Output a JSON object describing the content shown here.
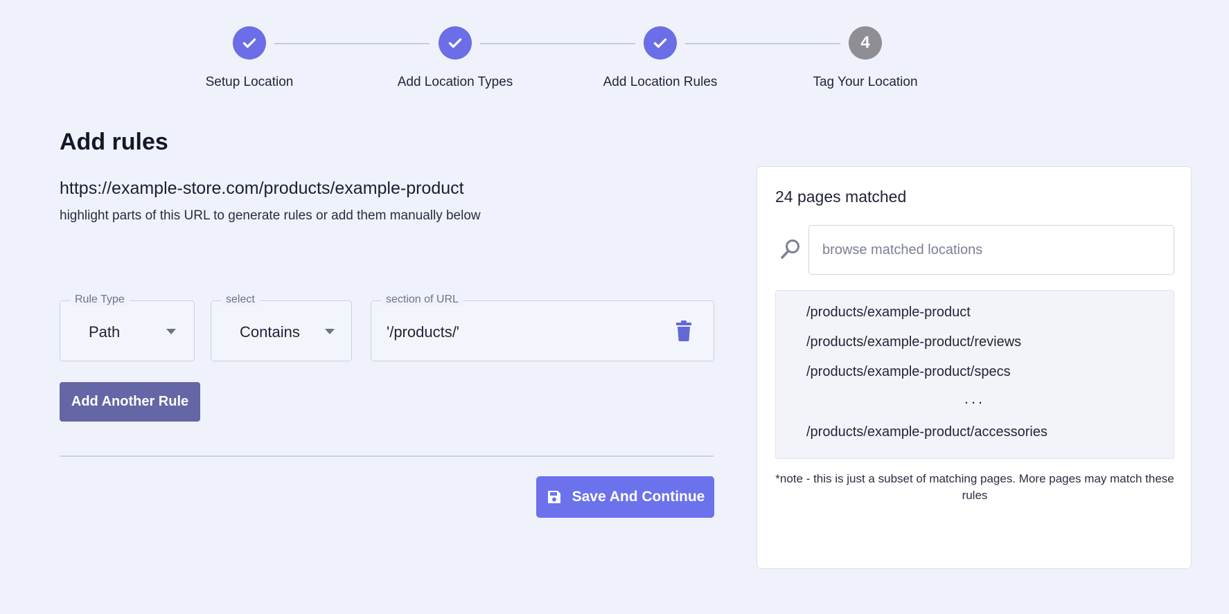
{
  "stepper": {
    "steps": [
      {
        "label": "Setup Location",
        "state": "complete"
      },
      {
        "label": "Add Location Types",
        "state": "complete"
      },
      {
        "label": "Add Location Rules",
        "state": "complete"
      },
      {
        "label": "Tag Your Location",
        "state": "pending",
        "number": "4"
      }
    ]
  },
  "main": {
    "title": "Add rules",
    "url": "https://example-store.com/products/example-product",
    "hint": "highlight parts of this URL to generate rules or add them manually below"
  },
  "rule": {
    "type_legend": "Rule Type",
    "type_value": "Path",
    "match_legend": "select",
    "match_value": "Contains",
    "section_legend": "section of URL",
    "section_value": "'/products/'"
  },
  "actions": {
    "add_rule_label": "Add Another Rule",
    "save_label": "Save And Continue"
  },
  "panel": {
    "matched_count": "24 pages matched",
    "search_placeholder": "browse matched locations",
    "results": [
      "/products/example-product",
      "/products/example-product/reviews",
      "/products/example-product/specs",
      "/products/example-product/accessories"
    ],
    "ellipsis": "...",
    "note": "*note - this is just a subset of matching pages. More pages may match these rules"
  },
  "colors": {
    "accent": "#6b6ee6",
    "pending_step": "#8e8e94",
    "add_rule_button": "#6466a6",
    "save_button": "#6b72ec",
    "background": "#eff2fa"
  }
}
